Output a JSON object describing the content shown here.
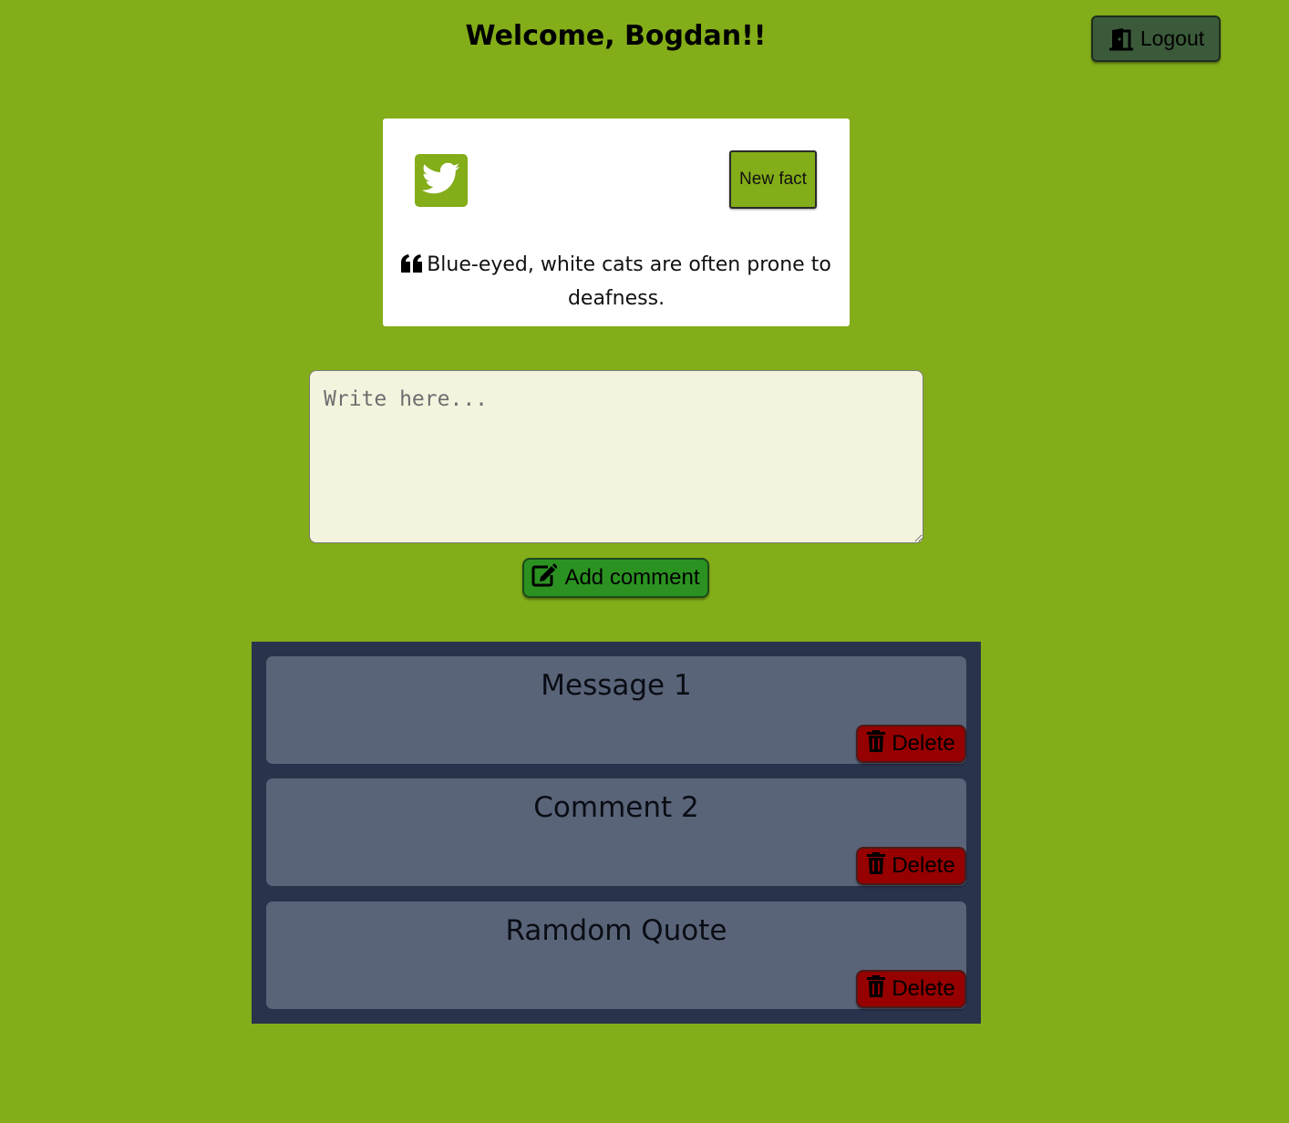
{
  "header": {
    "welcome": "Welcome, Bogdan!!",
    "logout_label": "Logout"
  },
  "fact_card": {
    "new_fact_label": "New fact",
    "fact_text": "Blue-eyed, white cats are often prone to deafness."
  },
  "comment_form": {
    "placeholder": "Write here...",
    "value": "",
    "add_label": "Add comment"
  },
  "comments": [
    {
      "text": "Message 1",
      "delete_label": "Delete"
    },
    {
      "text": "Comment 2",
      "delete_label": "Delete"
    },
    {
      "text": "Ramdom Quote",
      "delete_label": "Delete"
    }
  ],
  "icons": {
    "logout": "door-exit-icon",
    "twitter": "twitter-icon",
    "quote": "quote-left-icon",
    "add": "edit-icon",
    "delete": "trash-icon"
  },
  "colors": {
    "background": "#83ad19",
    "logout_button": "#3b5a3a",
    "add_button": "#2b9222",
    "delete_button": "#960000",
    "comments_panel": "#29334c",
    "comment_card": "#5a6479",
    "input_background": "#f4f3de"
  }
}
